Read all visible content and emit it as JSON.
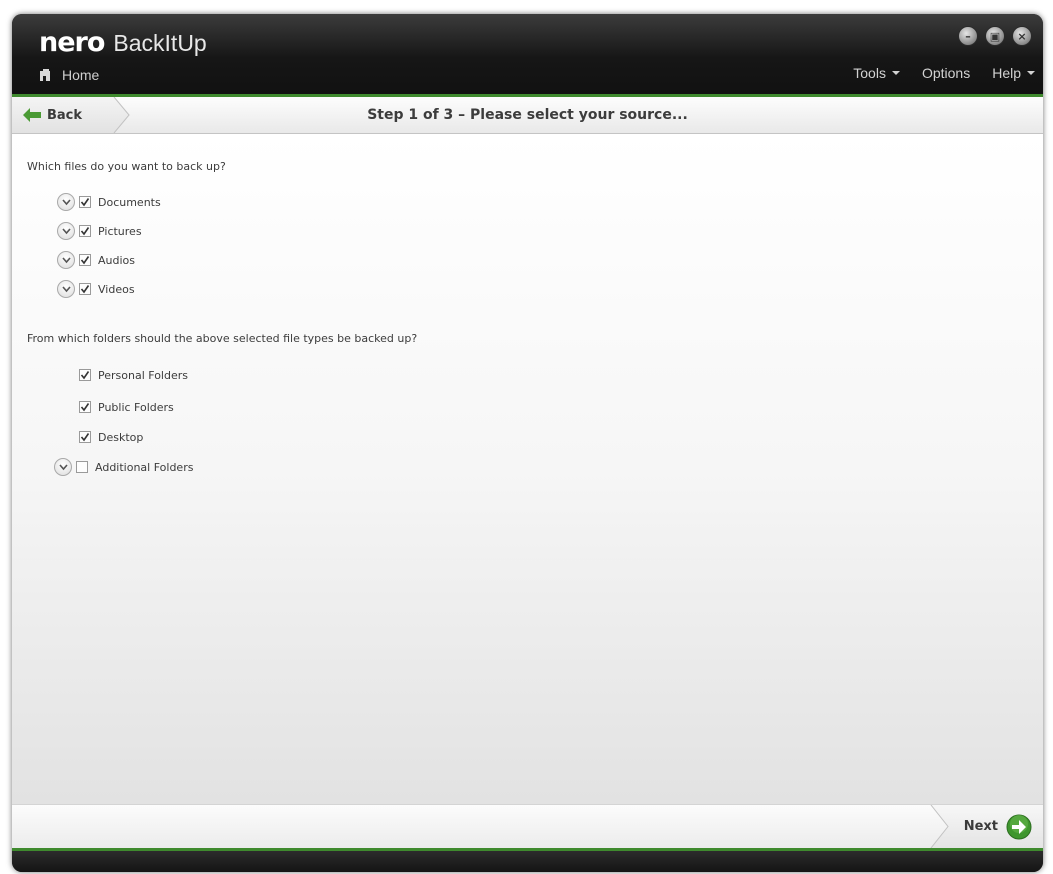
{
  "app": {
    "brand": "nero",
    "product": "BackItUp"
  },
  "nav": {
    "home_label": "Home",
    "menu": [
      {
        "label": "Tools",
        "has_dropdown": true
      },
      {
        "label": "Options",
        "has_dropdown": false
      },
      {
        "label": "Help",
        "has_dropdown": true
      }
    ]
  },
  "window_controls": [
    "minimize-icon",
    "maximize-icon",
    "close-icon"
  ],
  "stepbar": {
    "back_label": "Back",
    "title": "Step 1 of 3 – Please select your source..."
  },
  "file_types": {
    "question": "Which files do you want to back up?",
    "items": [
      {
        "label": "Documents",
        "checked": true,
        "expandable": true
      },
      {
        "label": "Pictures",
        "checked": true,
        "expandable": true
      },
      {
        "label": "Audios",
        "checked": true,
        "expandable": true
      },
      {
        "label": "Videos",
        "checked": true,
        "expandable": true
      }
    ]
  },
  "folders": {
    "question": "From which folders should the above selected file types be backed up?",
    "items": [
      {
        "label": "Personal Folders",
        "checked": true,
        "expandable": false
      },
      {
        "label": "Public Folders",
        "checked": true,
        "expandable": false
      },
      {
        "label": "Desktop",
        "checked": true,
        "expandable": false
      },
      {
        "label": "Additional Folders",
        "checked": false,
        "expandable": true
      }
    ]
  },
  "footer": {
    "next_label": "Next"
  },
  "colors": {
    "accent_green": "#3f8a2e",
    "titlebar_dark": "#161616",
    "text": "#3c3c3c"
  }
}
